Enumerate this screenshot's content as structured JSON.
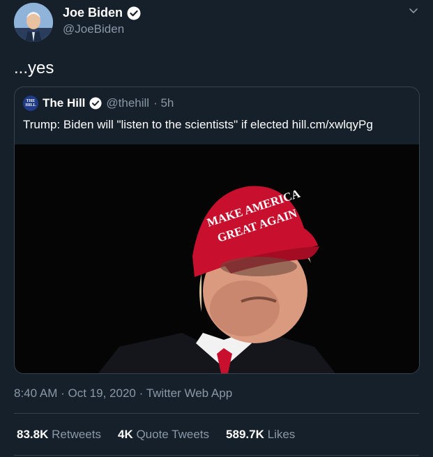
{
  "author": {
    "name": "Joe Biden",
    "handle": "@JoeBiden"
  },
  "tweet": {
    "text": "...yes"
  },
  "quote": {
    "logo_text": "THE HILL",
    "name": "The Hill",
    "handle": "@thehill",
    "time": "· 5h",
    "text": "Trump: Biden will \"listen to the scientists\" if elected hill.cm/xwlqyPg",
    "image_hat_text_line1": "MAKE AMERICA",
    "image_hat_text_line2": "GREAT AGAIN"
  },
  "meta": {
    "time": "8:40 AM",
    "sep1": "·",
    "date": "Oct 19, 2020",
    "sep2": "·",
    "app": "Twitter Web App"
  },
  "stats": {
    "retweets_num": "83.8K",
    "retweets_label": "Retweets",
    "quotes_num": "4K",
    "quotes_label": "Quote Tweets",
    "likes_num": "589.7K",
    "likes_label": "Likes"
  },
  "colors": {
    "background": "#15202b",
    "secondary_text": "#8b98a5",
    "border": "#38444d",
    "hat_red": "#c8102e",
    "verified_blue": "#ffffff"
  }
}
